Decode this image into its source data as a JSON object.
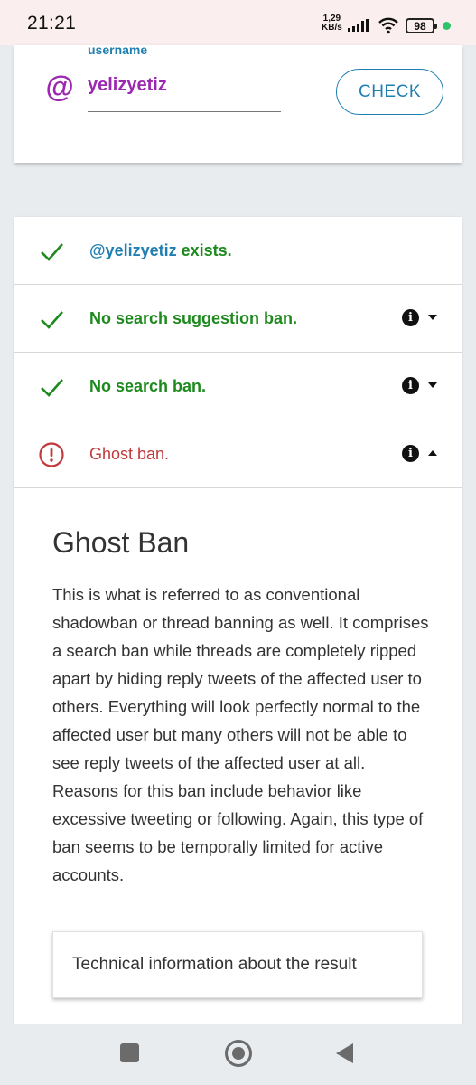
{
  "status_bar": {
    "time": "21:21",
    "net_speed_value": "1,29",
    "net_speed_unit": "KB/s",
    "battery": "98"
  },
  "username_card": {
    "label": "username",
    "at_symbol": "@",
    "value": "yelizyetiz",
    "check_label": "CHECK",
    "accent_color": "#9c27b0",
    "link_color": "#1f7fb0"
  },
  "results": [
    {
      "handle": "@yelizyetiz",
      "text": " exists.",
      "status": "ok",
      "icon": "check-icon"
    },
    {
      "text": "No search suggestion ban.",
      "status": "ok",
      "icon": "check-icon"
    },
    {
      "text": "No search ban.",
      "status": "ok",
      "icon": "check-icon"
    },
    {
      "text": "Ghost ban.",
      "status": "error",
      "icon": "alert-circle-icon"
    }
  ],
  "details": {
    "title": "Ghost Ban",
    "body": "This is what is referred to as conventional shadowban or thread banning as well. It comprises a search ban while threads are completely ripped apart by hiding reply tweets of the affected user to others. Everything will look perfectly normal to the affected user but many others will not be able to see reply tweets of the affected user at all. Reasons for this ban include behavior like excessive tweeting or following. Again, this type of ban seems to be temporally limited for active accounts.",
    "technical_button": "Technical information about the result"
  },
  "colors": {
    "ok": "#1e8a1e",
    "error": "#c0393b"
  }
}
